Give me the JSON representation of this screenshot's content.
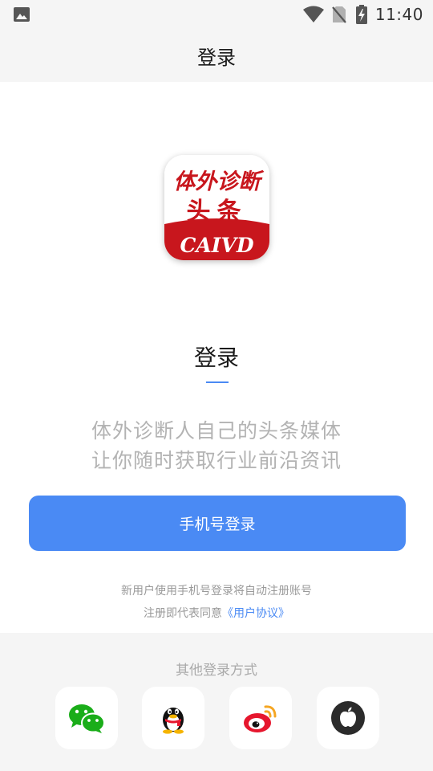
{
  "status_bar": {
    "time": "11:40",
    "icons": [
      "gallery-icon",
      "wifi-icon",
      "no-sim-icon",
      "battery-charging-icon"
    ]
  },
  "app_bar": {
    "title": "登录"
  },
  "logo": {
    "line1": "体外诊断",
    "line2": "头条",
    "line3": "CAIVD",
    "colors": {
      "red": "#c8161d",
      "white": "#ffffff"
    }
  },
  "main": {
    "heading": "登录",
    "slogan_line1": "体外诊断人自己的头条媒体",
    "slogan_line2": "让你随时获取行业前沿资讯",
    "phone_login_label": "手机号登录",
    "notice_line1": "新用户使用手机号登录将自动注册账号",
    "notice_line2_prefix": "注册即代表同意",
    "agreement_link": "《用户协议》"
  },
  "other_login": {
    "title": "其他登录方式",
    "options": [
      {
        "name": "wechat",
        "icon": "wechat-icon",
        "color": "#1aad19"
      },
      {
        "name": "qq",
        "icon": "qq-penguin-icon",
        "color": "#000000"
      },
      {
        "name": "weibo",
        "icon": "weibo-icon",
        "color": "#e6162d"
      },
      {
        "name": "apple",
        "icon": "apple-icon",
        "color": "#2b2b2b"
      }
    ]
  },
  "colors": {
    "accent": "#4a8af4",
    "panel_bg": "#f5f5f5",
    "muted_text": "#b3b3b3"
  }
}
